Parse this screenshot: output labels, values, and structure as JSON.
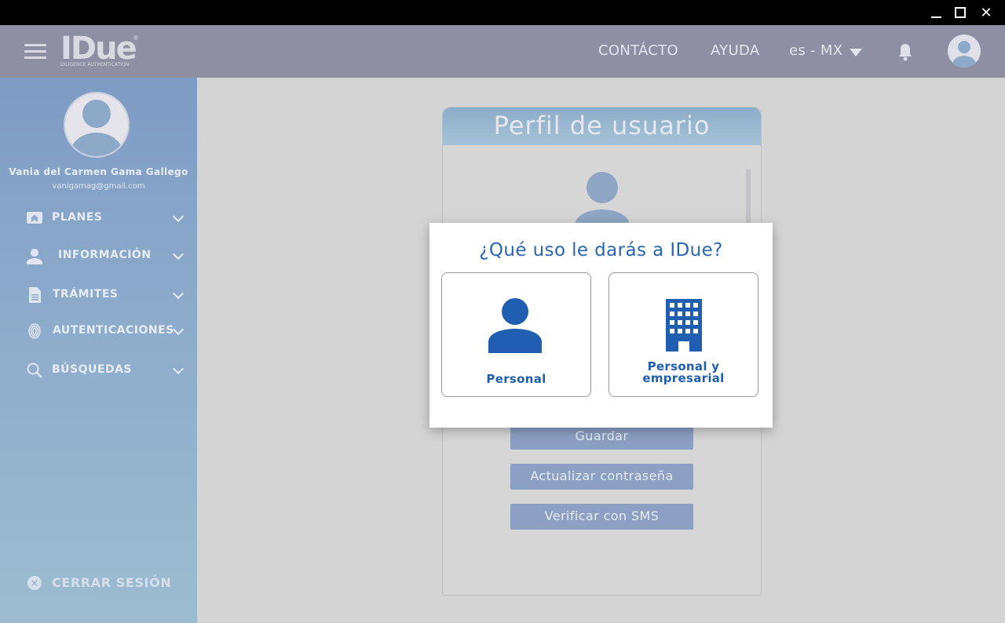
{
  "header": {
    "logo": "IDue",
    "logo_tagline": "DILIGENCE AUTHENTICATION",
    "logo_mark": "®",
    "nav": {
      "contact": "CONTÁCTO",
      "help": "AYUDA",
      "language": "es - MX"
    }
  },
  "sidebar": {
    "user_name": "Vania del Carmen Gama Gallego",
    "user_email": "vanigamag@gmail.com",
    "items": [
      {
        "label": "PLANES",
        "icon": "plans-icon"
      },
      {
        "label": "INFORMACIÓN",
        "icon": "person-icon"
      },
      {
        "label": "TRÁMITES",
        "icon": "document-icon"
      },
      {
        "label": "AUTENTICACIONES",
        "icon": "fingerprint-icon"
      },
      {
        "label": "BÚSQUEDAS",
        "icon": "search-icon"
      }
    ],
    "logout": "CERRAR SESIÓN"
  },
  "card": {
    "title": "Perfil de usuario",
    "buttons": {
      "save": "Guardar",
      "update_password": "Actualizar contraseña",
      "verify_sms": "Verificar con SMS"
    }
  },
  "modal": {
    "title": "¿Qué uso le darás a IDue?",
    "options": [
      {
        "label": "Personal",
        "icon": "person-icon"
      },
      {
        "label": "Personal y empresarial",
        "label_line1": "Personal y",
        "label_line2": "empresarial",
        "icon": "building-icon"
      }
    ]
  },
  "colors": {
    "accent": "#1f5eb0",
    "header_bg": "#8f8fa4",
    "sidebar_bg": "#8aa8c8"
  }
}
